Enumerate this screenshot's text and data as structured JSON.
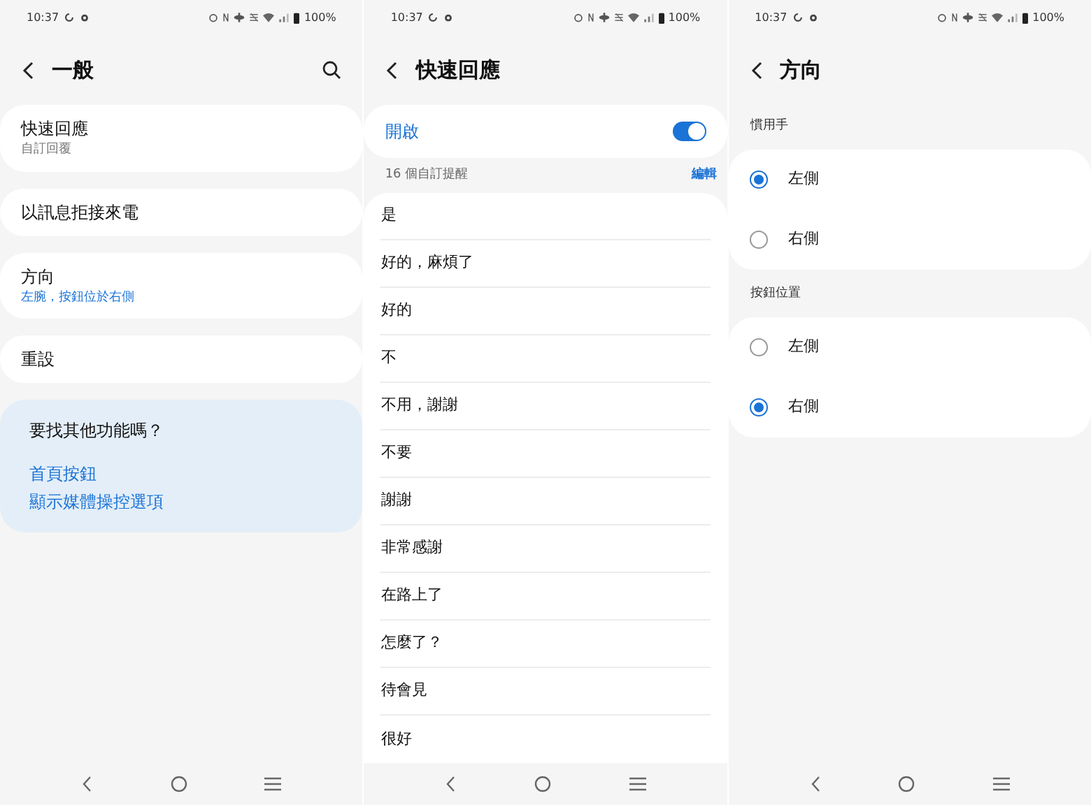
{
  "screens": [
    {
      "kind": "menu",
      "status_bar": {
        "time": "10:37",
        "battery": "100%"
      },
      "title": "一般",
      "has_search": true,
      "items": [
        {
          "title": "快速回應",
          "subtitle": "自訂回覆",
          "subtitle_highlighted": false
        },
        {
          "title": "以訊息拒接來電"
        },
        {
          "title": "方向",
          "subtitle": "左腕，按鈕位於右側",
          "subtitle_highlighted": true
        },
        {
          "title": "重設"
        }
      ],
      "suggestions": {
        "heading": "要找其他功能嗎？",
        "links": [
          "首頁按鈕",
          "顯示媒體操控選項"
        ]
      }
    },
    {
      "kind": "quick_replies",
      "status_bar": {
        "time": "10:37",
        "battery": "100%"
      },
      "title": "快速回應",
      "master_switch": {
        "label": "開啟",
        "on": true
      },
      "list_header": {
        "count": "16 個自訂提醒",
        "action": "編輯"
      },
      "replies": [
        "是",
        "好的，麻煩了",
        "好的",
        "不",
        "不用，謝謝",
        "不要",
        "謝謝",
        "非常感謝",
        "在路上了",
        "怎麼了？",
        "待會見",
        "很好"
      ]
    },
    {
      "kind": "radio_groups",
      "status_bar": {
        "time": "10:37",
        "battery": "100%"
      },
      "title": "方向",
      "groups": [
        {
          "heading": "慣用手",
          "options": [
            {
              "label": "左側",
              "selected": true
            },
            {
              "label": "右側",
              "selected": false
            }
          ]
        },
        {
          "heading": "按鈕位置",
          "options": [
            {
              "label": "左側",
              "selected": false
            },
            {
              "label": "右側",
              "selected": true
            }
          ]
        }
      ]
    }
  ]
}
